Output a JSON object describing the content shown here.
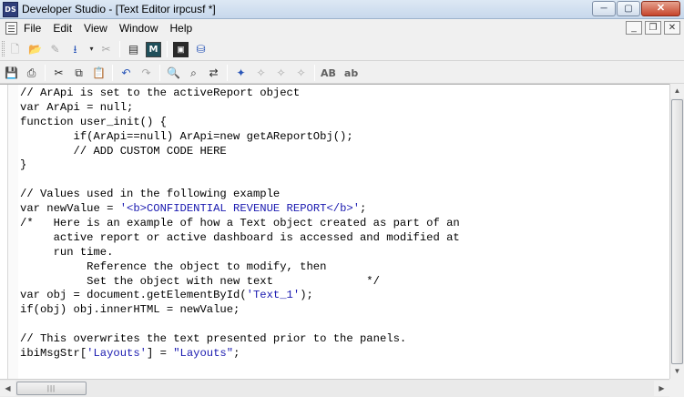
{
  "window": {
    "app_icon_label": "DS",
    "title": "Developer Studio - [Text Editor irpcusf *]",
    "minimize_glyph": "─",
    "maximize_glyph": "▢",
    "close_glyph": "✕"
  },
  "menubar": {
    "items": [
      "File",
      "Edit",
      "View",
      "Window",
      "Help"
    ],
    "mdi_minimize_glyph": "_",
    "mdi_restore_glyph": "❐",
    "mdi_close_glyph": "✕"
  },
  "toolbar1": {
    "icons": {
      "new": "🗋",
      "open": "📂",
      "edit": "✎",
      "save_drop": "⭳",
      "dropdown": "▾",
      "cut_disabled": "✂",
      "properties": "▤",
      "m_button": "M",
      "terminal": "▣",
      "database": "⛁"
    }
  },
  "toolbar2": {
    "icons": {
      "save": "💾",
      "print": "⎙",
      "cut": "✂",
      "copy": "⧉",
      "paste": "📋",
      "undo": "↶",
      "redo": "↷",
      "find": "🔍",
      "find_next": "⌕",
      "replace": "⇄",
      "bookmark": "✦",
      "bookmark_next": "✧",
      "bookmark_prev": "✧",
      "bookmark_clear": "✧"
    },
    "uppercase_label": "AB",
    "lowercase_label": "ab"
  },
  "editor": {
    "lines": [
      {
        "text": "// ArApi is set to the activeReport object"
      },
      {
        "text": "var ArApi = null;"
      },
      {
        "text": "function user_init() {"
      },
      {
        "text": "        if(ArApi==null) ArApi=new getAReportObj();"
      },
      {
        "text": "        // ADD CUSTOM CODE HERE"
      },
      {
        "text": "}"
      },
      {
        "text": ""
      },
      {
        "text": "// Values used in the following example"
      },
      {
        "pre": "var newValue = ",
        "str": "'<b>CONFIDENTIAL REVENUE REPORT</b>'",
        "post": ";"
      },
      {
        "text": "/*   Here is an example of how a Text object created as part of an"
      },
      {
        "text": "     active report or active dashboard is accessed and modified at"
      },
      {
        "text": "     run time."
      },
      {
        "text": "          Reference the object to modify, then"
      },
      {
        "text": "          Set the object with new text              */"
      },
      {
        "pre": "var obj = document.getElementById(",
        "str": "'Text_1'",
        "post": ");"
      },
      {
        "text": "if(obj) obj.innerHTML = newValue;"
      },
      {
        "text": ""
      },
      {
        "text": "// This overwrites the text presented prior to the panels."
      },
      {
        "pre": "ibiMsgStr[",
        "str": "'Layouts'",
        "mid": "] = ",
        "str2": "\"Layouts\"",
        "post": ";"
      }
    ]
  },
  "scrollbars": {
    "up_glyph": "▲",
    "down_glyph": "▼",
    "left_glyph": "◀",
    "right_glyph": "▶",
    "thumb_grip": "|||"
  }
}
